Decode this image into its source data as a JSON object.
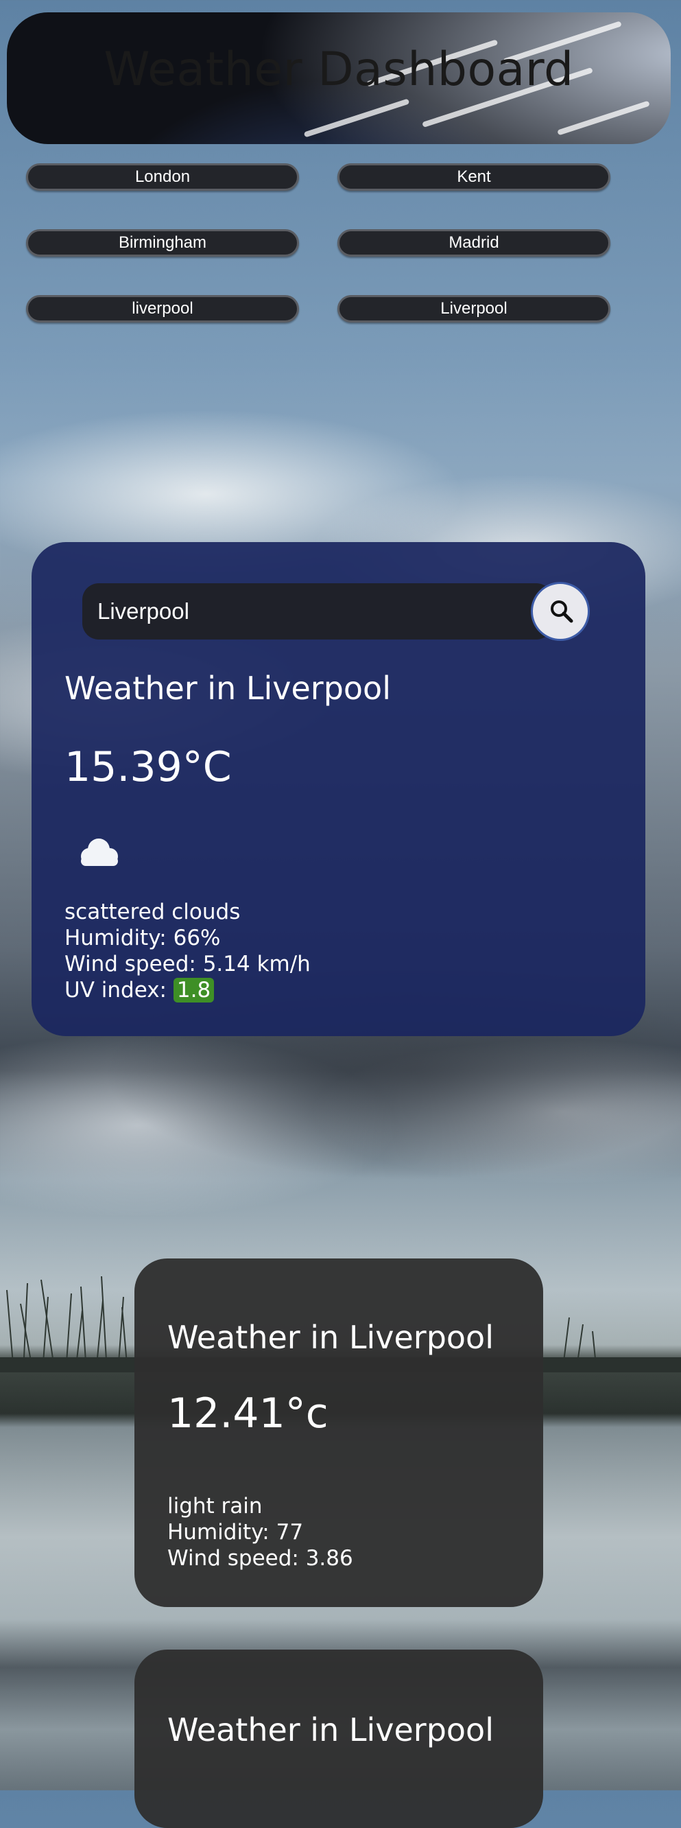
{
  "header": {
    "title": "Weather Dashboard"
  },
  "cities": [
    {
      "label": "London"
    },
    {
      "label": "Kent"
    },
    {
      "label": "Birmingham"
    },
    {
      "label": "Madrid"
    },
    {
      "label": "liverpool"
    },
    {
      "label": "Liverpool"
    }
  ],
  "current": {
    "search_value": "Liverpool",
    "title": "Weather in Liverpool",
    "temperature": "15.39°C",
    "icon": "cloud-icon",
    "description": "scattered clouds",
    "humidity": "Humidity: 66%",
    "wind": "Wind speed: 5.14 km/h",
    "uv_label": "UV index:",
    "uv_value": "1.8",
    "uv_color": "#3e8f26"
  },
  "forecast": [
    {
      "title": "Weather in Liverpool",
      "temperature": "12.41°c",
      "description": "light rain",
      "humidity": "Humidity: 77",
      "wind": "Wind speed: 3.86"
    },
    {
      "title": "Weather in Liverpool"
    }
  ],
  "colors": {
    "main_card": "#1a2660",
    "forecast_card": "#2e2e2e",
    "city_button": "#23252a",
    "uv_low": "#3e8f26"
  }
}
